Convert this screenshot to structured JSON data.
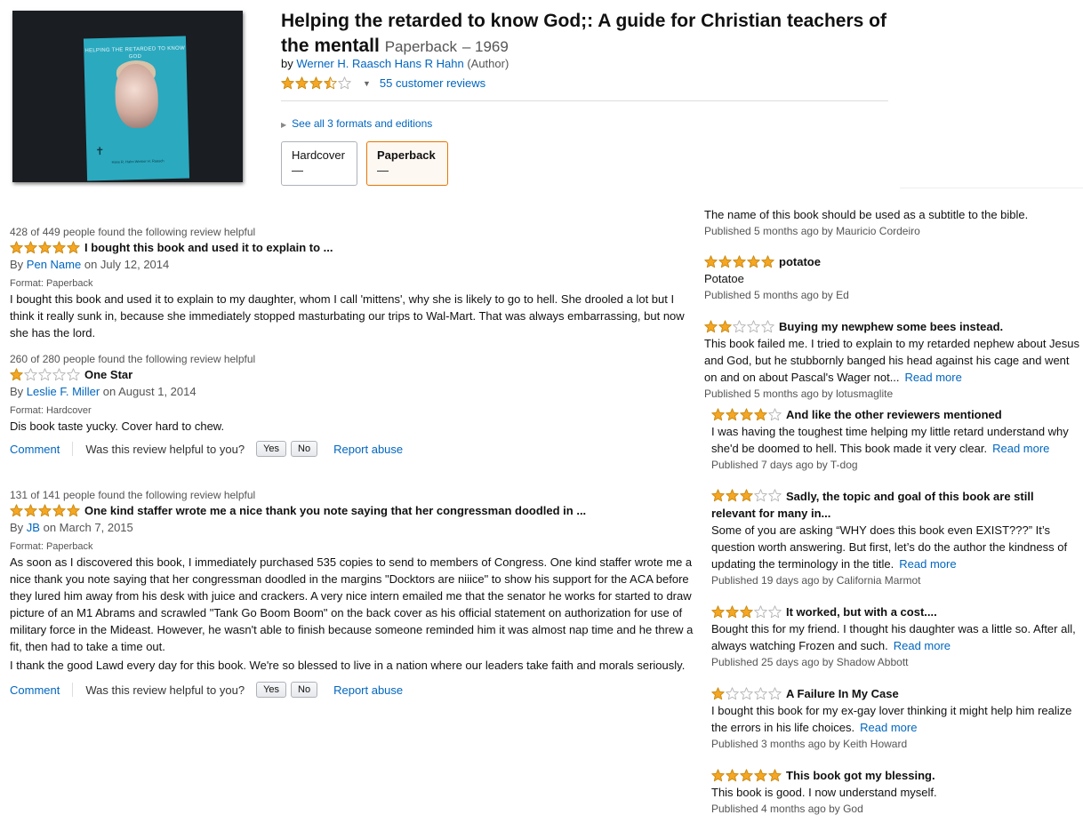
{
  "product": {
    "title": "Helping the retarded to know God;: A guide for Christian teachers of the mentall",
    "format_label": "Paperback",
    "year": "– 1969",
    "by_label": "by",
    "author_link": "Werner H. Raasch Hans R Hahn",
    "author_role": "(Author)",
    "rating": 3.5,
    "reviews_link": "55 customer reviews",
    "see_all": "See all 3 formats and editions",
    "cover_title": "HELPING THE RETARDED TO KNOW GOD",
    "cover_authors": "Hans R. Hahn Werner H. Raasch"
  },
  "formats": [
    {
      "label": "Hardcover",
      "price": "—",
      "selected": false
    },
    {
      "label": "Paperback",
      "price": "—",
      "selected": true
    }
  ],
  "left_reviews": [
    {
      "helpful": "428 of 449 people found the following review helpful",
      "stars": 5,
      "title": "I bought this book and used it to explain to ...",
      "by": "By",
      "author": "Pen Name",
      "date": "on July 12, 2014",
      "format": "Format: Paperback",
      "body": "I bought this book and used it to explain to my daughter, whom I call 'mittens', why she is likely to go to hell. She drooled a lot but I think it really sunk in, because she immediately stopped masturbating our trips to Wal-Mart. That was always embarrassing, but now she has the lord."
    },
    {
      "helpful": "260 of 280 people found the following review helpful",
      "stars": 1,
      "title": "One Star",
      "by": "By",
      "author": "Leslie F. Miller",
      "date": "on August 1, 2014",
      "format": "Format: Hardcover",
      "body": "Dis book taste yucky. Cover hard to chew."
    },
    {
      "helpful": "131 of 141 people found the following review helpful",
      "stars": 5,
      "title": "One kind staffer wrote me a nice thank you note saying that her congressman doodled in ...",
      "by": "By",
      "author": "JB",
      "date": "on March 7, 2015",
      "format": "Format: Paperback",
      "body": "As soon as I discovered this book, I immediately purchased 535 copies to send to members of Congress. One kind staffer wrote me a nice thank you note saying that her congressman doodled in the margins \"Docktors are niiice\" to show his support for the ACA before they lured him away from his desk with juice and crackers. A very nice intern emailed me that the senator he works for started to draw picture of an M1 Abrams and scrawled \"Tank Go Boom Boom\" on the back cover as his official statement on authorization for use of military force in the Mideast. However, he wasn't able to finish because someone reminded him it was almost nap time and he threw a fit, then had to take a time out.",
      "body2": "I thank the good Lawd every day for this book. We're so blessed to live in a nation where our leaders take faith and morals seriously."
    }
  ],
  "actions": {
    "comment": "Comment",
    "question": "Was this review helpful to you?",
    "yes": "Yes",
    "no": "No",
    "report": "Report abuse"
  },
  "right_reviews": [
    {
      "stars": 0,
      "title": "",
      "body": "The name of this book should be used as a subtitle to the bible.",
      "read_more": "",
      "published": "Published 5 months ago by Mauricio Cordeiro"
    },
    {
      "stars": 5,
      "title": "potatoe",
      "body": "Potatoe",
      "read_more": "",
      "published": "Published 5 months ago by Ed"
    },
    {
      "stars": 2,
      "title": "Buying my newphew some bees instead.",
      "body": "This book failed me. I tried to explain to my retarded nephew about Jesus and God, but he stubbornly banged his head against his cage and went on and on about Pascal's Wager not...",
      "read_more": "Read more",
      "published": "Published 5 months ago by lotusmaglite"
    },
    {
      "stars": 4,
      "title": "And like the other reviewers mentioned",
      "body": "I was having the toughest time helping my little retard understand why she'd be doomed to hell. This book made it very clear.",
      "read_more": "Read more",
      "published": "Published 7 days ago by T-dog"
    },
    {
      "stars": 3,
      "title": "Sadly, the topic and goal of this book are still relevant for many in...",
      "body": "Some of you are asking “WHY does this book even EXIST???” It’s question worth answering. But first, let’s do the author the kindness of updating the terminology in the title.",
      "read_more": "Read more",
      "published": "Published 19 days ago by California Marmot"
    },
    {
      "stars": 3,
      "title": "It worked, but with a cost....",
      "body": "Bought this for my friend. I thought his daughter was a little so. After all, always watching Frozen and such.",
      "read_more": "Read more",
      "published": "Published 25 days ago by Shadow Abbott"
    },
    {
      "stars": 1,
      "title": "A Failure In My Case",
      "body": "I bought this book for my ex-gay lover thinking it might help him realize the errors in his life choices.",
      "read_more": "Read more",
      "published": "Published 3 months ago by Keith Howard"
    },
    {
      "stars": 5,
      "title": "This book got my blessing.",
      "body": "This book is good. I now understand myself.",
      "read_more": "",
      "published": "Published 4 months ago by God"
    }
  ],
  "colors": {
    "star_fill": "#f5a623",
    "star_stroke": "#c7880f",
    "star_empty_stroke": "#b3b3b3",
    "link": "#0066c0",
    "selected_border": "#e77600"
  }
}
